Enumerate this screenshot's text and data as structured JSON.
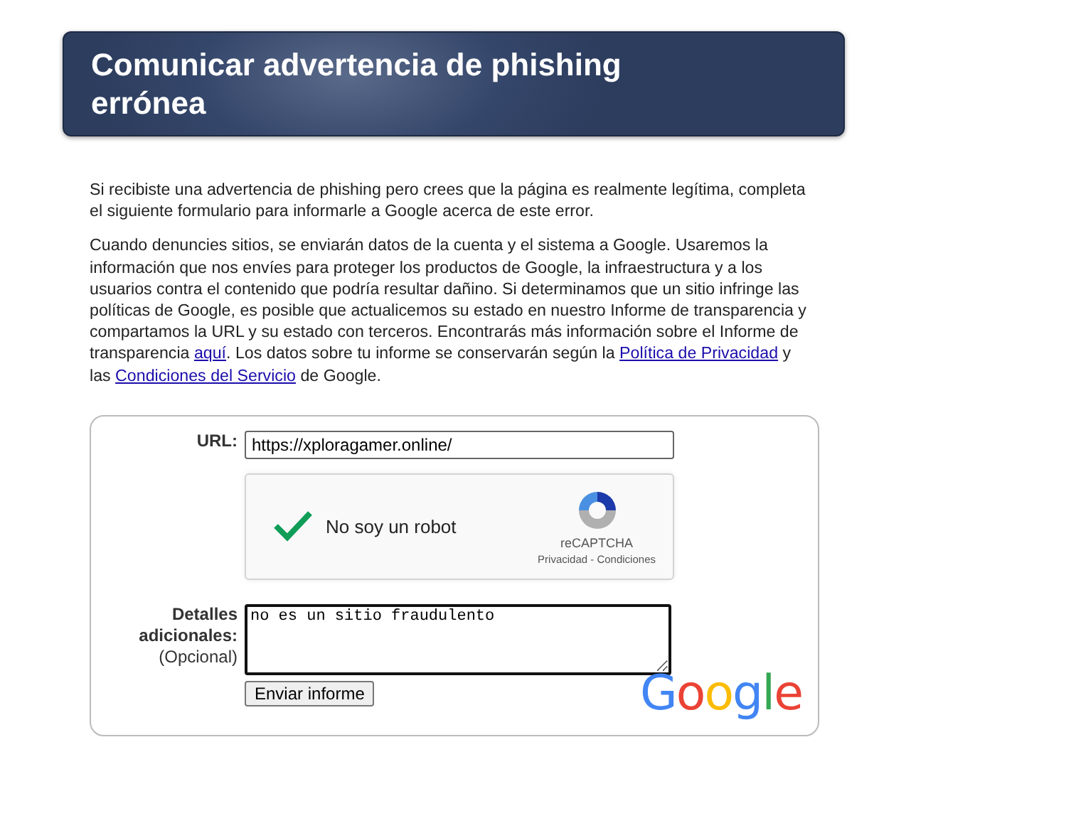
{
  "header": {
    "title": "Comunicar advertencia de phishing errónea"
  },
  "intro": [
    [
      {
        "text": "Si recibiste una advertencia de phishing pero crees que la página es realmente legítima, completa el siguiente formulario para informarle a Google acerca de este error.",
        "link": false
      }
    ],
    [
      {
        "text": "Cuando denuncies sitios, se enviarán datos de la cuenta y el sistema a Google. Usaremos la información que nos envíes para proteger los productos de Google, la infraestructura y a los usuarios contra el contenido que podría resultar dañino. Si determinamos que un sitio infringe las políticas de Google, es posible que actualicemos su estado en nuestro Informe de transparencia y compartamos la URL y su estado con terceros. Encontrarás más información sobre el Informe de transparencia ",
        "link": false
      },
      {
        "text": "aquí",
        "link": true
      },
      {
        "text": ". Los datos sobre tu informe se conservarán según la ",
        "link": false
      },
      {
        "text": "Política de Privacidad",
        "link": true
      },
      {
        "text": " y las ",
        "link": false
      },
      {
        "text": "Condiciones del Servicio",
        "link": true
      },
      {
        "text": " de Google.",
        "link": false
      }
    ]
  ],
  "form": {
    "url_label": "URL:",
    "url_value": "https://xploragamer.online/",
    "captcha": {
      "checked": true,
      "label": "No soy un robot",
      "brand": "reCAPTCHA",
      "terms": "Privacidad - Condiciones"
    },
    "details_label": "Detalles adicionales:",
    "details_hint": "(Opcional)",
    "details_value": "no es un sitio fraudulento",
    "submit": "Enviar informe",
    "logo": "Google"
  }
}
